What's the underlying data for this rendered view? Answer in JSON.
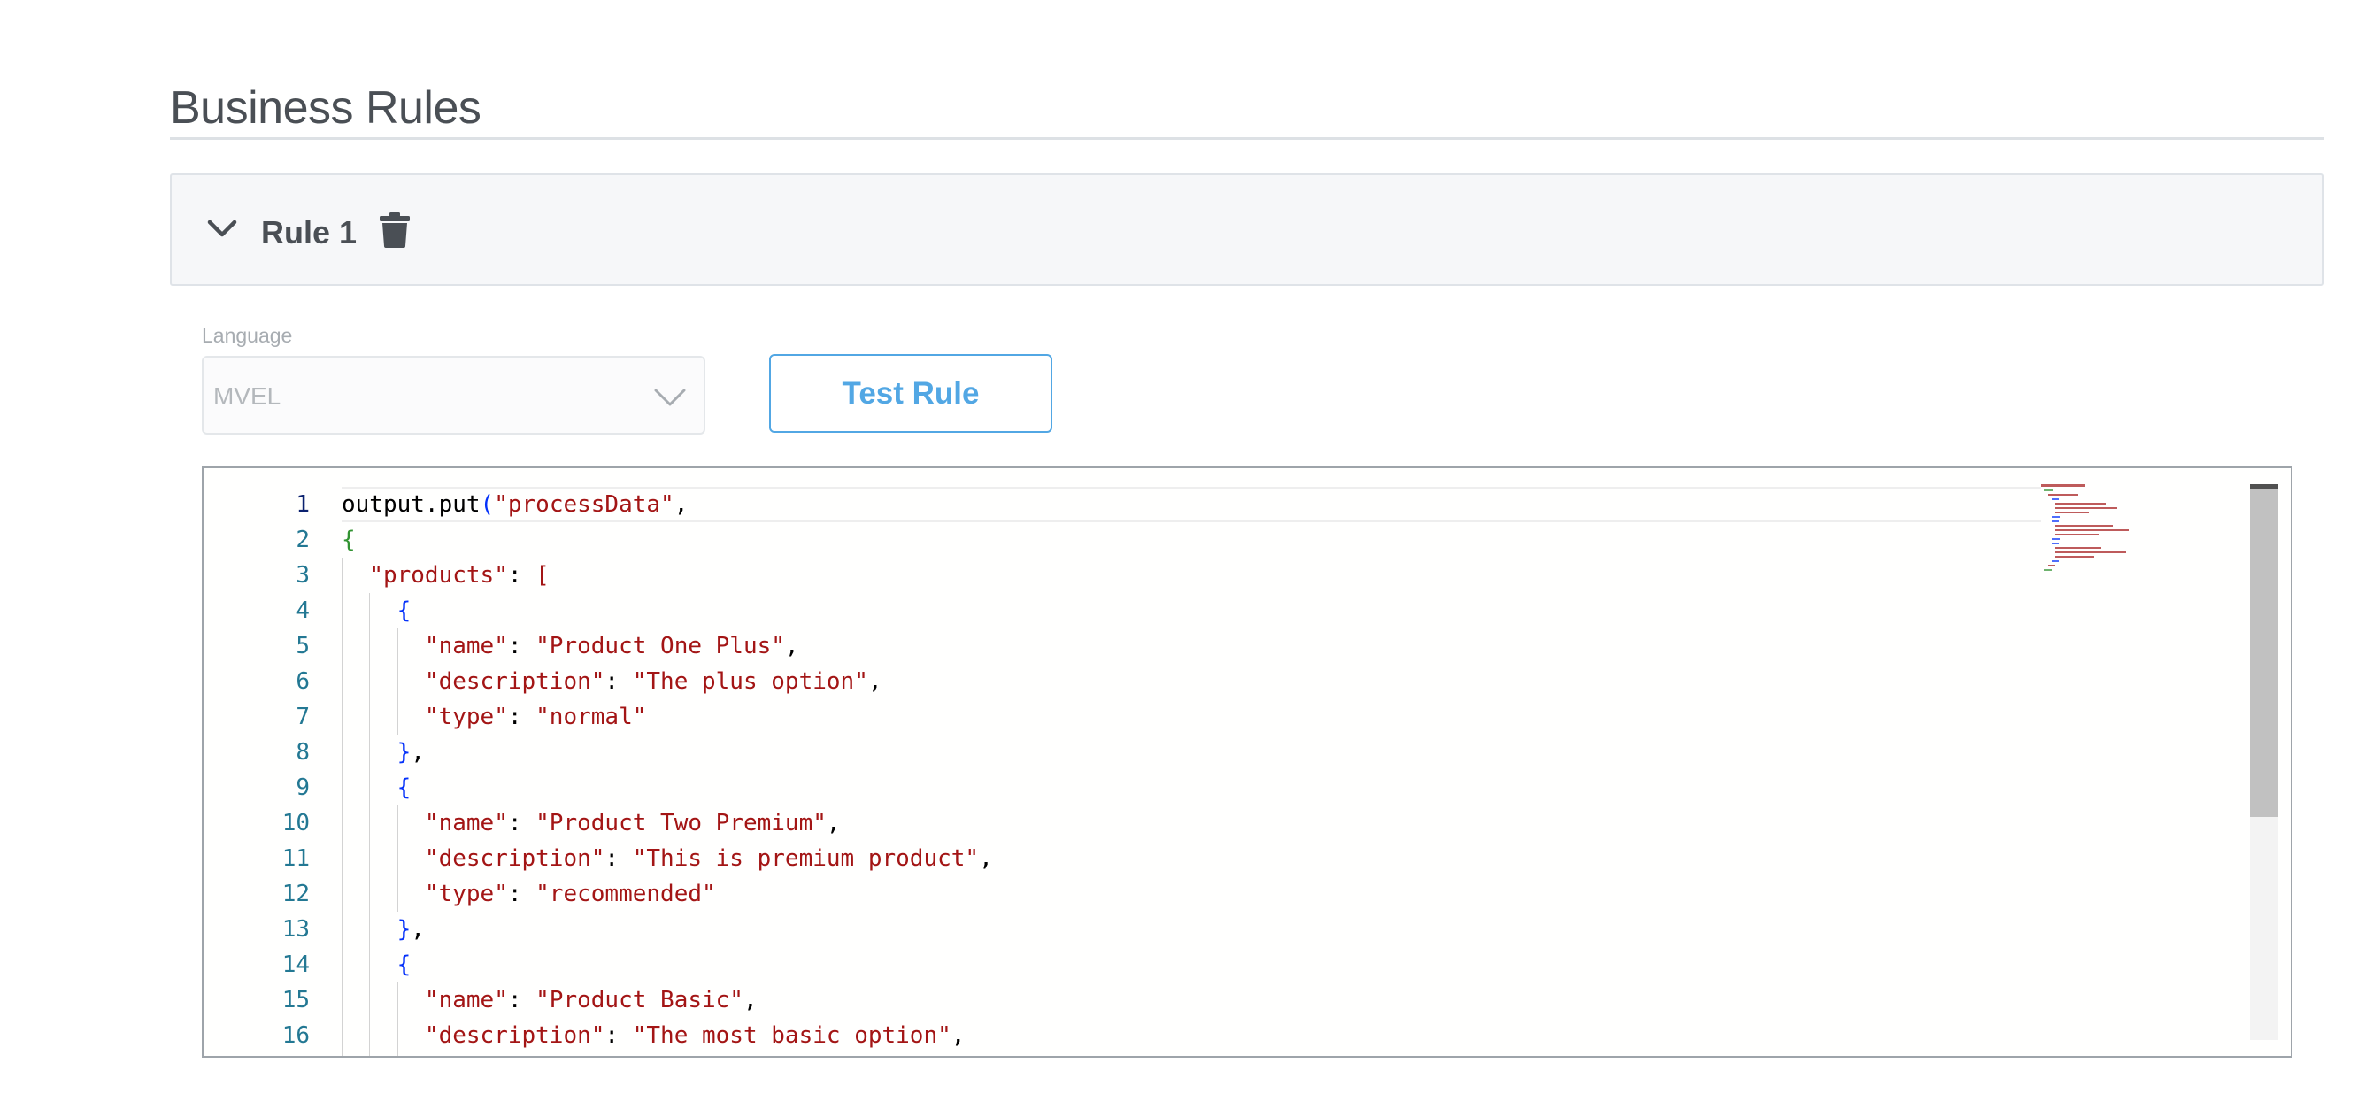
{
  "page": {
    "title": "Business Rules"
  },
  "rule": {
    "title": "Rule 1",
    "collapse_icon": "chevron-down-icon",
    "delete_icon": "trash-icon"
  },
  "form": {
    "language_label": "Language",
    "language_value": "MVEL",
    "test_button_label": "Test Rule"
  },
  "editor": {
    "lines": [
      {
        "n": "1",
        "tokens": [
          [
            "plain",
            "output.put"
          ],
          [
            "paren",
            "("
          ],
          [
            "str",
            "\"processData\""
          ],
          [
            "plain",
            ","
          ]
        ]
      },
      {
        "n": "2",
        "tokens": [
          [
            "brace1",
            "{"
          ]
        ]
      },
      {
        "n": "3",
        "tokens": [
          [
            "plain",
            "  "
          ],
          [
            "str",
            "\"products\""
          ],
          [
            "plain",
            ": "
          ],
          [
            "bracket",
            "["
          ]
        ]
      },
      {
        "n": "4",
        "tokens": [
          [
            "plain",
            "    "
          ],
          [
            "brace2",
            "{"
          ]
        ]
      },
      {
        "n": "5",
        "tokens": [
          [
            "plain",
            "      "
          ],
          [
            "str",
            "\"name\""
          ],
          [
            "plain",
            ": "
          ],
          [
            "str",
            "\"Product One Plus\""
          ],
          [
            "plain",
            ","
          ]
        ]
      },
      {
        "n": "6",
        "tokens": [
          [
            "plain",
            "      "
          ],
          [
            "str",
            "\"description\""
          ],
          [
            "plain",
            ": "
          ],
          [
            "str",
            "\"The plus option\""
          ],
          [
            "plain",
            ","
          ]
        ]
      },
      {
        "n": "7",
        "tokens": [
          [
            "plain",
            "      "
          ],
          [
            "str",
            "\"type\""
          ],
          [
            "plain",
            ": "
          ],
          [
            "str",
            "\"normal\""
          ]
        ]
      },
      {
        "n": "8",
        "tokens": [
          [
            "plain",
            "    "
          ],
          [
            "brace2",
            "}"
          ],
          [
            "plain",
            ","
          ]
        ]
      },
      {
        "n": "9",
        "tokens": [
          [
            "plain",
            "    "
          ],
          [
            "brace2",
            "{"
          ]
        ]
      },
      {
        "n": "10",
        "tokens": [
          [
            "plain",
            "      "
          ],
          [
            "str",
            "\"name\""
          ],
          [
            "plain",
            ": "
          ],
          [
            "str",
            "\"Product Two Premium\""
          ],
          [
            "plain",
            ","
          ]
        ]
      },
      {
        "n": "11",
        "tokens": [
          [
            "plain",
            "      "
          ],
          [
            "str",
            "\"description\""
          ],
          [
            "plain",
            ": "
          ],
          [
            "str",
            "\"This is premium product\""
          ],
          [
            "plain",
            ","
          ]
        ]
      },
      {
        "n": "12",
        "tokens": [
          [
            "plain",
            "      "
          ],
          [
            "str",
            "\"type\""
          ],
          [
            "plain",
            ": "
          ],
          [
            "str",
            "\"recommended\""
          ]
        ]
      },
      {
        "n": "13",
        "tokens": [
          [
            "plain",
            "    "
          ],
          [
            "brace2",
            "}"
          ],
          [
            "plain",
            ","
          ]
        ]
      },
      {
        "n": "14",
        "tokens": [
          [
            "plain",
            "    "
          ],
          [
            "brace2",
            "{"
          ]
        ]
      },
      {
        "n": "15",
        "tokens": [
          [
            "plain",
            "      "
          ],
          [
            "str",
            "\"name\""
          ],
          [
            "plain",
            ": "
          ],
          [
            "str",
            "\"Product Basic\""
          ],
          [
            "plain",
            ","
          ]
        ]
      },
      {
        "n": "16",
        "tokens": [
          [
            "plain",
            "      "
          ],
          [
            "str",
            "\"description\""
          ],
          [
            "plain",
            ": "
          ],
          [
            "str",
            "\"The most basic option\""
          ],
          [
            "plain",
            ","
          ]
        ]
      }
    ]
  },
  "colors": {
    "accent": "#52a7e4",
    "string": "#a31515",
    "line_number": "#237893",
    "line_number_active": "#0b216f"
  }
}
